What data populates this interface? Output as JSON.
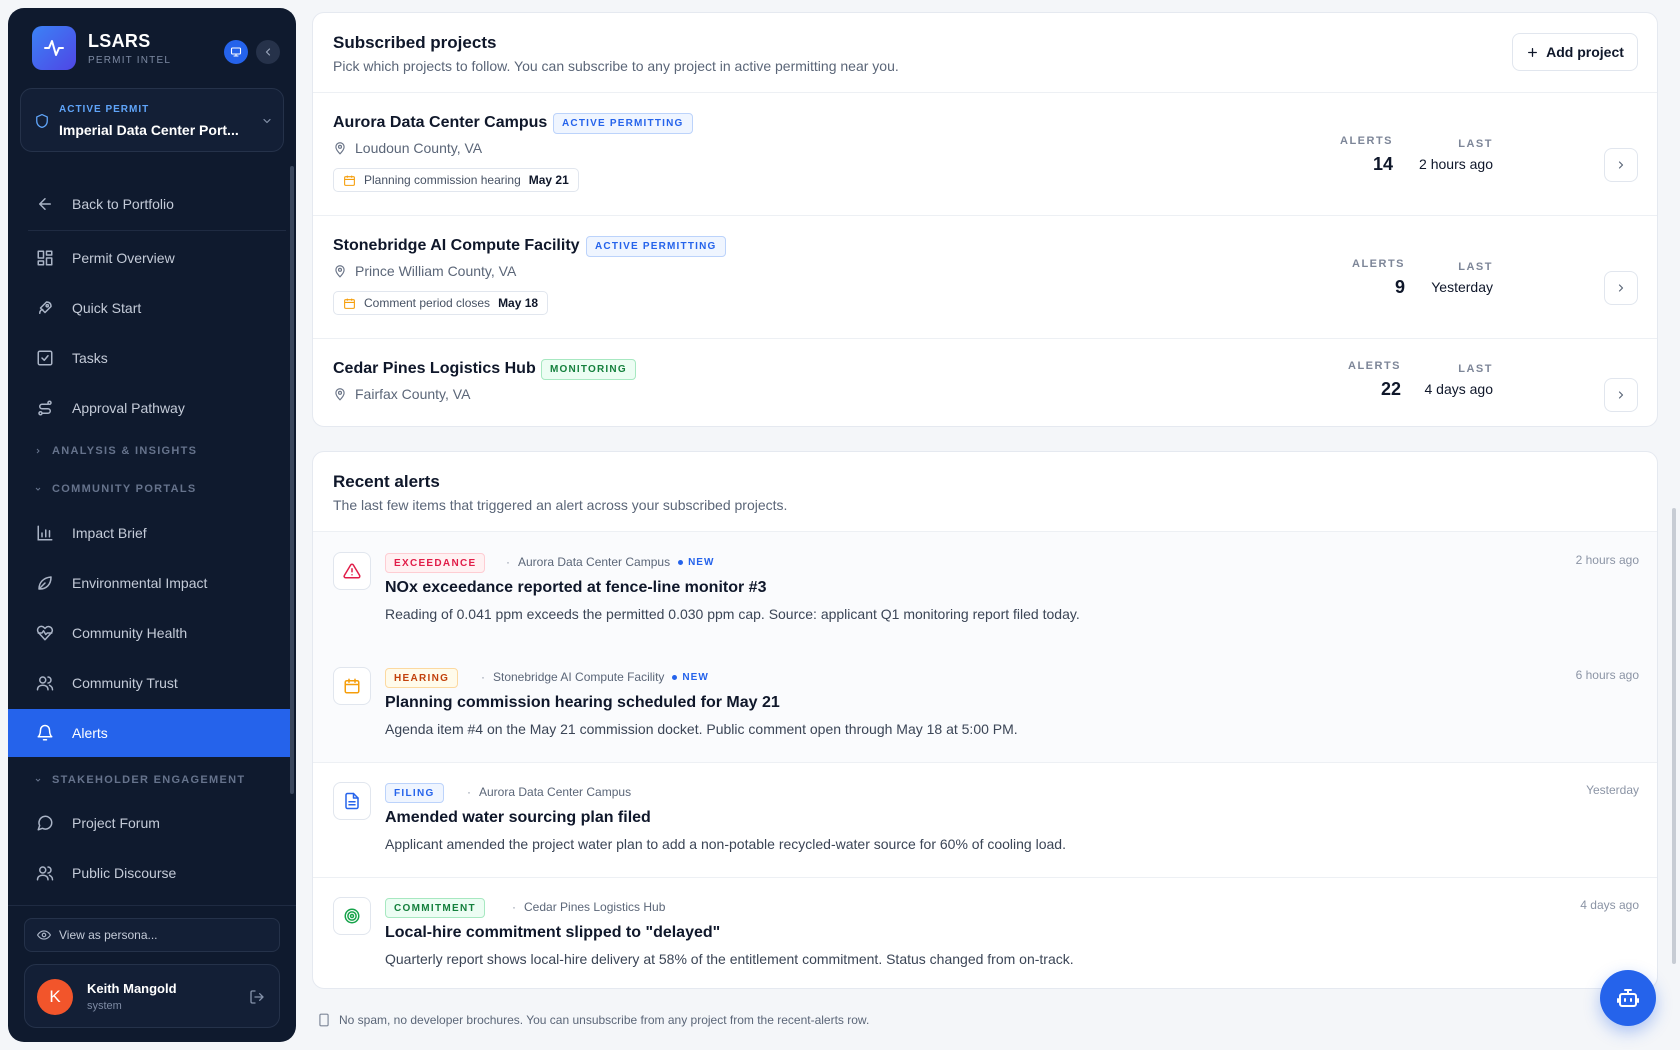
{
  "brand": {
    "name": "LSARS",
    "subtitle": "PERMIT INTEL"
  },
  "active_permit": {
    "label": "ACTIVE PERMIT",
    "name": "Imperial Data Center Port..."
  },
  "nav": {
    "back": "Back to Portfolio",
    "permit_overview": "Permit Overview",
    "quick_start": "Quick Start",
    "tasks": "Tasks",
    "approval_pathway": "Approval Pathway",
    "section_analysis": "ANALYSIS & INSIGHTS",
    "section_community": "COMMUNITY PORTALS",
    "impact_brief": "Impact Brief",
    "environmental_impact": "Environmental Impact",
    "community_health": "Community Health",
    "community_trust": "Community Trust",
    "alerts": "Alerts",
    "section_stakeholder": "STAKEHOLDER ENGAGEMENT",
    "project_forum": "Project Forum",
    "public_discourse": "Public Discourse"
  },
  "persona": {
    "label": "View as persona..."
  },
  "user": {
    "initial": "K",
    "name": "Keith Mangold",
    "role": "system"
  },
  "subscribed": {
    "title": "Subscribed projects",
    "subtitle": "Pick which projects to follow. You can subscribe to any project in active permitting near you.",
    "add_label": "Add project",
    "alerts_label": "ALERTS",
    "last_label": "LAST",
    "projects": [
      {
        "name": "Aurora Data Center Campus",
        "status": "ACTIVE PERMITTING",
        "location": "Loudoun County, VA",
        "event": "Planning commission hearing",
        "event_date": "May 21",
        "alerts": "14",
        "last": "2 hours ago"
      },
      {
        "name": "Stonebridge AI Compute Facility",
        "status": "ACTIVE PERMITTING",
        "location": "Prince William County, VA",
        "event": "Comment period closes",
        "event_date": "May 18",
        "alerts": "9",
        "last": "Yesterday"
      },
      {
        "name": "Cedar Pines Logistics Hub",
        "status": "MONITORING",
        "location": "Fairfax County, VA",
        "alerts": "22",
        "last": "4 days ago"
      }
    ]
  },
  "recent": {
    "title": "Recent alerts",
    "subtitle": "The last few items that triggered an alert across your subscribed projects.",
    "new_label": "NEW",
    "items": [
      {
        "tag": "EXCEEDANCE",
        "project": "Aurora Data Center Campus",
        "title": "NOx exceedance reported at fence-line monitor #3",
        "body": "Reading of 0.041 ppm exceeds the permitted 0.030 ppm cap. Source: applicant Q1 monitoring report filed today.",
        "time": "2 hours ago"
      },
      {
        "tag": "HEARING",
        "project": "Stonebridge AI Compute Facility",
        "title": "Planning commission hearing scheduled for May 21",
        "body": "Agenda item #4 on the May 21 commission docket. Public comment open through May 18 at 5:00 PM.",
        "time": "6 hours ago"
      },
      {
        "tag": "FILING",
        "project": "Aurora Data Center Campus",
        "title": "Amended water sourcing plan filed",
        "body": "Applicant amended the project water plan to add a non-potable recycled-water source for 60% of cooling load.",
        "time": "Yesterday"
      },
      {
        "tag": "COMMITMENT",
        "project": "Cedar Pines Logistics Hub",
        "title": "Local-hire commitment slipped to \"delayed\"",
        "body": "Quarterly report shows local-hire delivery at 58% of the entitlement commitment. Status changed from on-track.",
        "time": "4 days ago"
      }
    ]
  },
  "footer": {
    "note": "No spam, no developer brochures. You can unsubscribe from any project from the recent-alerts row."
  },
  "colors": {
    "sidebar_bg": "#0f1a2e",
    "accent": "#2563eb",
    "page_bg": "#f4f6f9"
  },
  "icons": {
    "logo": "activity-pulse-icon",
    "present": "monitor-icon",
    "collapse": "chevron-left-icon",
    "permit": "shield-icon",
    "fab": "bot-icon",
    "footer": "device-icon"
  }
}
